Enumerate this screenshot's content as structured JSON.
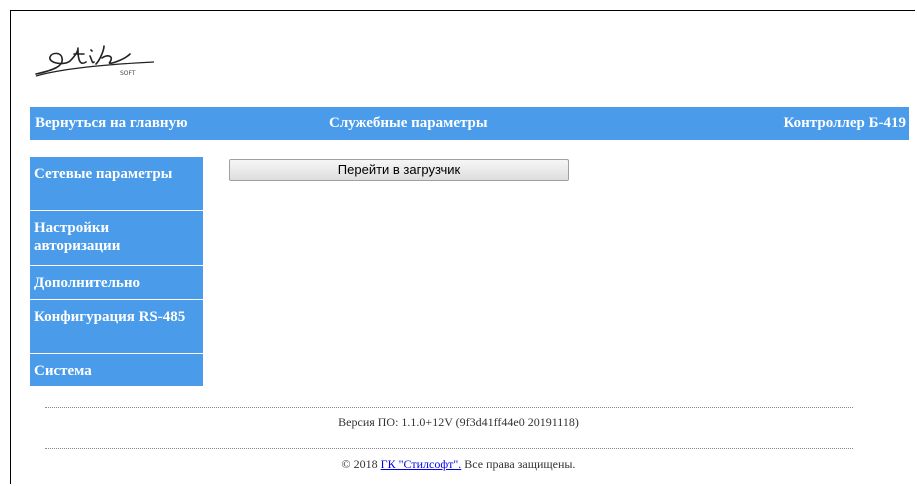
{
  "logo": {
    "brand": "Stil",
    "sub": "SOFT"
  },
  "header": {
    "back_link": "Вернуться на главную",
    "title": "Служебные параметры",
    "device": "Контроллер Б-419"
  },
  "sidebar": {
    "items": [
      {
        "label": "Сетевые параметры"
      },
      {
        "label": "Настройки авторизации"
      },
      {
        "label": "Дополнительно"
      },
      {
        "label": "Конфигурация RS-485"
      },
      {
        "label": "Система"
      }
    ]
  },
  "main": {
    "loader_button": "Перейти в загрузчик"
  },
  "footer": {
    "version": "Версия ПО: 1.1.0+12V (9f3d41ff44e0 20191118)",
    "copyright_prefix": "© 2018 ",
    "company_link": "ГК \"Стилсофт\".",
    "copyright_suffix": " Все права защищены."
  },
  "colors": {
    "accent": "#4a9bea",
    "link": "#0000ee"
  }
}
